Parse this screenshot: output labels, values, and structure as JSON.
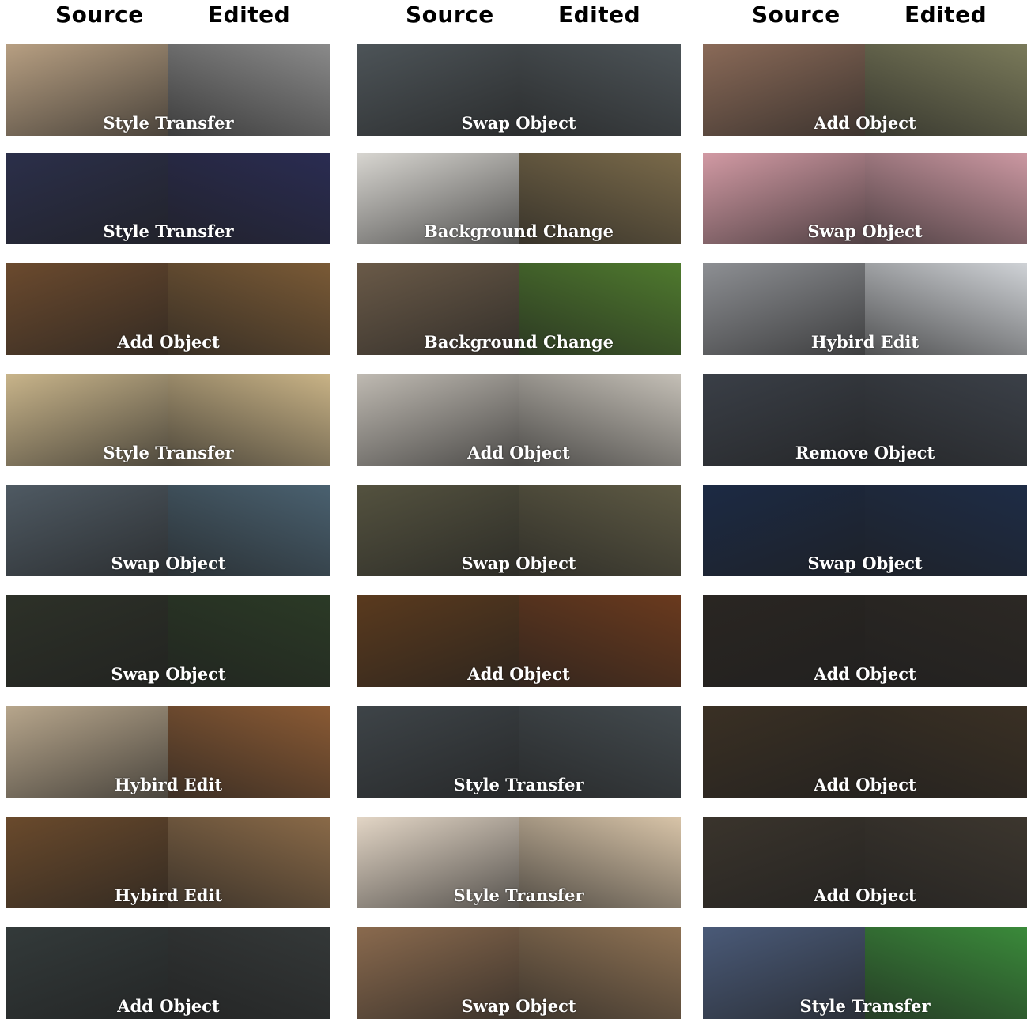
{
  "columns": [
    {
      "source_label": "Source",
      "edited_label": "Edited",
      "rows": [
        {
          "label": "Style Transfer",
          "src": "#b79f82",
          "edt": "#8a8a8a"
        },
        {
          "label": "Style Transfer",
          "src": "#2b2f4a",
          "edt": "#2a2c52"
        },
        {
          "label": "Add Object",
          "src": "#6b4a2e",
          "edt": "#7a5a36"
        },
        {
          "label": "Style Transfer",
          "src": "#c8b48a",
          "edt": "#c9b386"
        },
        {
          "label": "Swap Object",
          "src": "#4f5a63",
          "edt": "#4a6170"
        },
        {
          "label": "Swap Object",
          "src": "#2d3128",
          "edt": "#2b3a26"
        },
        {
          "label": "Hybird Edit",
          "src": "#b7a68c",
          "edt": "#8a5a34"
        },
        {
          "label": "Hybird Edit",
          "src": "#6a4a2c",
          "edt": "#8a6a48"
        },
        {
          "label": "Add Object",
          "src": "#333a3a",
          "edt": "#343838"
        }
      ]
    },
    {
      "source_label": "Source",
      "edited_label": "Edited",
      "rows": [
        {
          "label": "Swap Object",
          "src": "#4d5458",
          "edt": "#4d5458"
        },
        {
          "label": "Background Change",
          "src": "#d8d6d1",
          "edt": "#7a6a4a"
        },
        {
          "label": "Background Change",
          "src": "#6a5a48",
          "edt": "#4f7a2e"
        },
        {
          "label": "Add Object",
          "src": "#bfbab2",
          "edt": "#c4bfb6"
        },
        {
          "label": "Swap Object",
          "src": "#54523f",
          "edt": "#5e5a44"
        },
        {
          "label": "Add Object",
          "src": "#5a3a1e",
          "edt": "#6a3a1e"
        },
        {
          "label": "Style Transfer",
          "src": "#3e4448",
          "edt": "#434a4e"
        },
        {
          "label": "Style Transfer",
          "src": "#e3d6c6",
          "edt": "#d8c4a8"
        },
        {
          "label": "Swap Object",
          "src": "#8a6a4e",
          "edt": "#8e7254"
        }
      ]
    },
    {
      "source_label": "Source",
      "edited_label": "Edited",
      "rows": [
        {
          "label": "Add Object",
          "src": "#8a6a58",
          "edt": "#7a7a5a"
        },
        {
          "label": "Swap Object",
          "src": "#d29aa4",
          "edt": "#cc98a2"
        },
        {
          "label": "Hybird Edit",
          "src": "#8d8f93",
          "edt": "#cfd2d6"
        },
        {
          "label": "Remove Object",
          "src": "#3a3f47",
          "edt": "#3b4048"
        },
        {
          "label": "Swap Object",
          "src": "#1c2a44",
          "edt": "#1e2c46"
        },
        {
          "label": "Add Object",
          "src": "#2a2622",
          "edt": "#2c2824"
        },
        {
          "label": "Add Object",
          "src": "#3a3024",
          "edt": "#3a3024"
        },
        {
          "label": "Add Object",
          "src": "#3a342c",
          "edt": "#3c362e"
        },
        {
          "label": "Style Transfer",
          "src": "#4a5a78",
          "edt": "#3a8a3a"
        }
      ]
    }
  ]
}
